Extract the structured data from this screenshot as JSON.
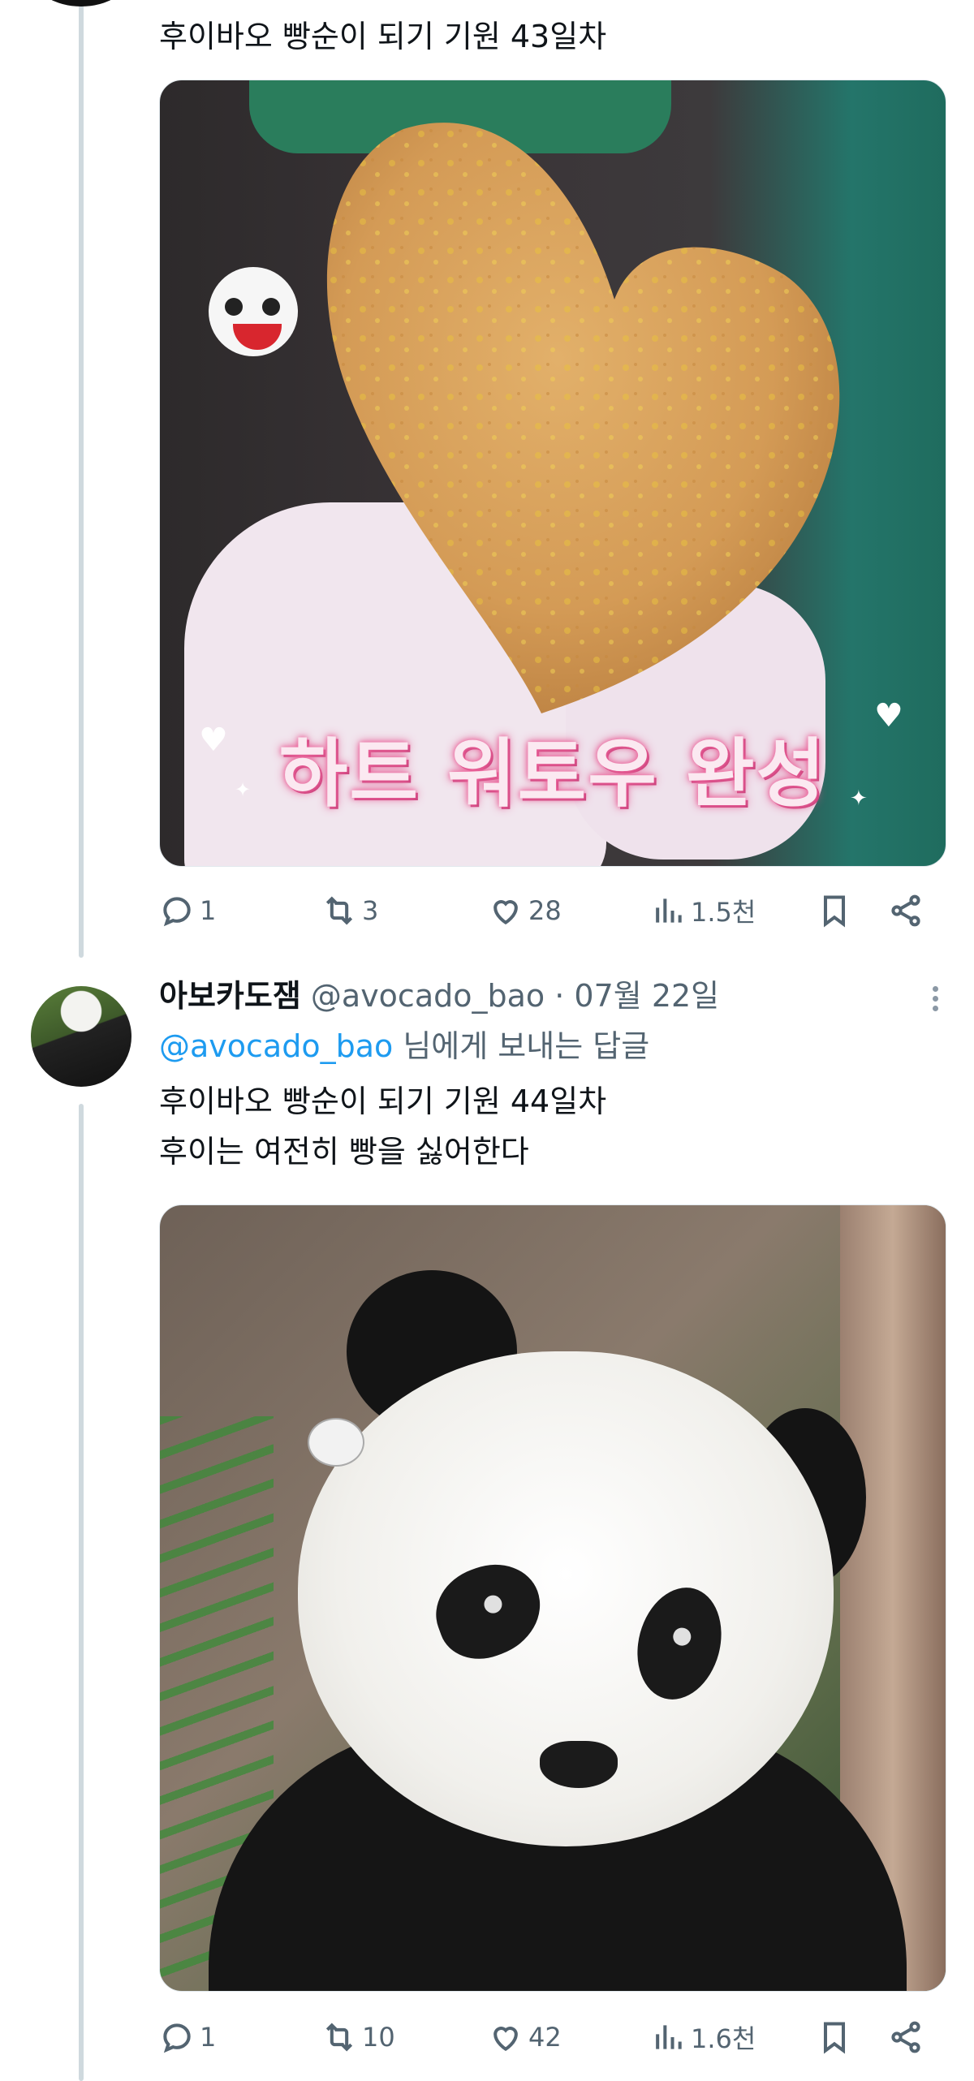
{
  "tweet1": {
    "text": "후이바오 빵순이 되기 기원 43일차",
    "media_caption": "하트 워토우 완성",
    "actions": {
      "replies": "1",
      "retweets": "3",
      "likes": "28",
      "views": "1.5천"
    }
  },
  "tweet2": {
    "display_name": "아보카도잼",
    "handle": "@avocado_bao",
    "separator": "·",
    "date": "07월 22일",
    "replying_to_handle": "@avocado_bao",
    "replying_to_suffix": "님에게 보내는 답글",
    "text_line1": "후이바오 빵순이 되기 기원 44일차",
    "text_line2": "후이는 여전히 빵을 싫어한다",
    "actions": {
      "replies": "1",
      "retweets": "10",
      "likes": "42",
      "views": "1.6천"
    }
  },
  "icons": {
    "reply": "reply-icon",
    "retweet": "retweet-icon",
    "like": "heart-icon",
    "views": "views-icon",
    "bookmark": "bookmark-icon",
    "share": "share-icon",
    "more": "more-icon"
  },
  "colors": {
    "link": "#1d9bf0",
    "secondary": "#536471",
    "caption": "#fbe9f1"
  }
}
